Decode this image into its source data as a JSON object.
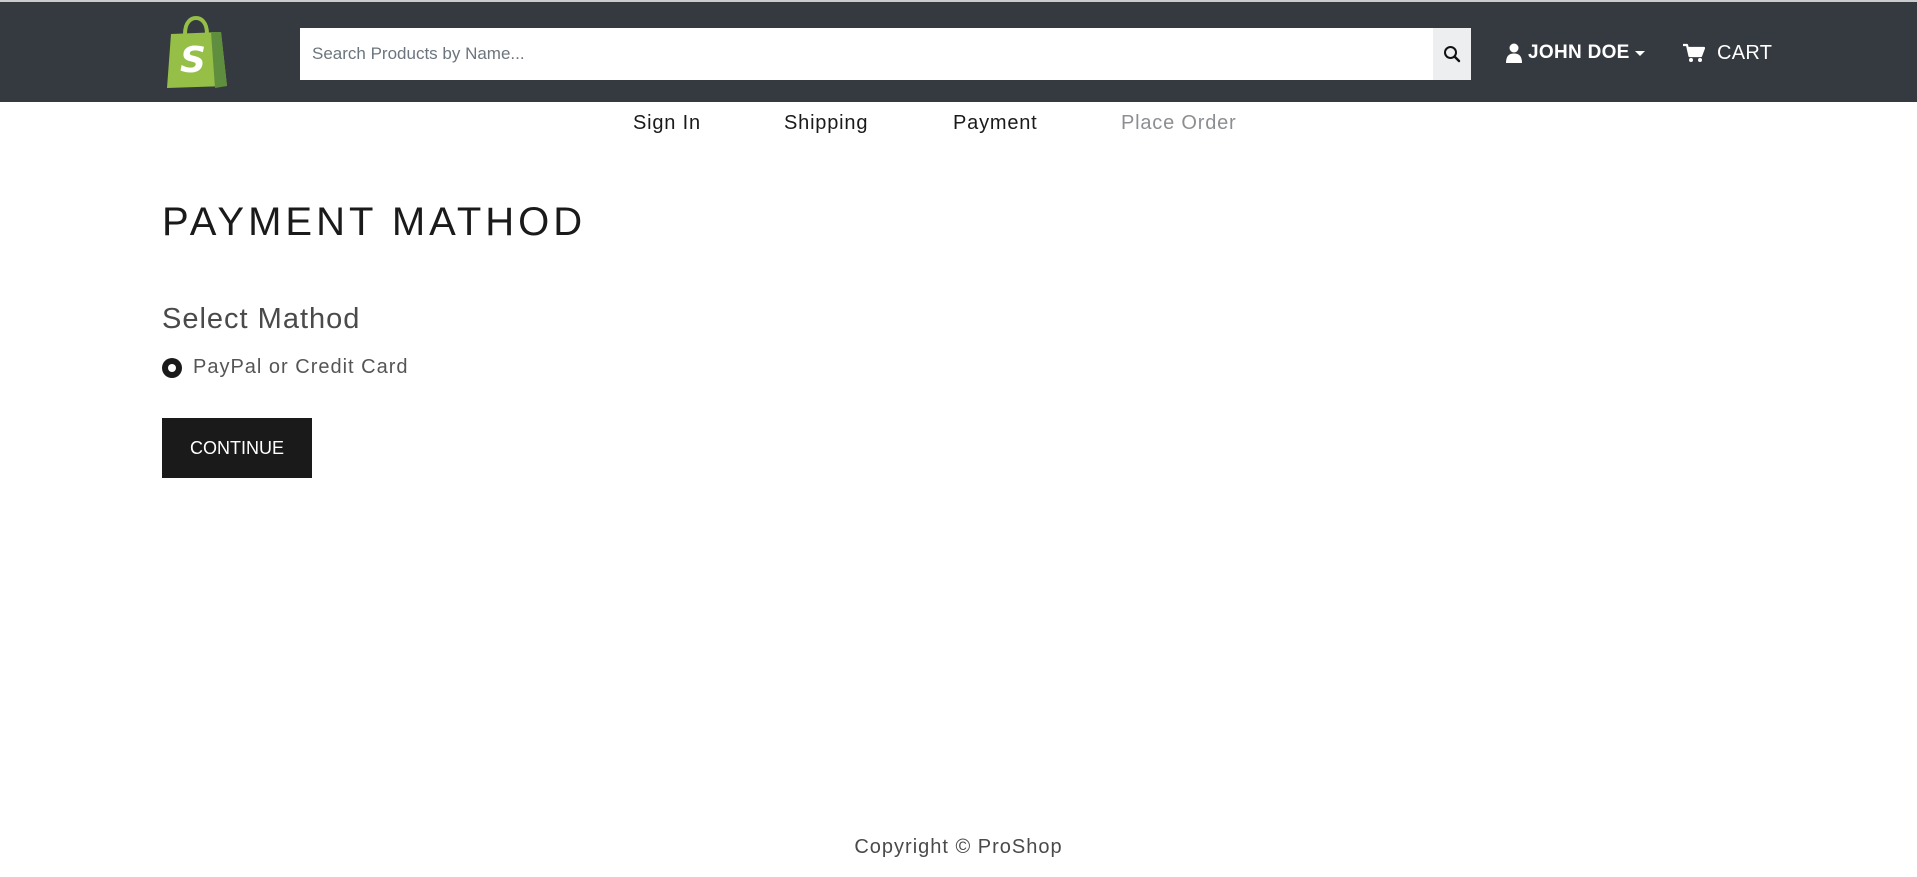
{
  "header": {
    "logo_icon": "shopify-bag-logo",
    "search": {
      "placeholder": "Search Products by Name...",
      "value": ""
    },
    "user_menu": {
      "label": "JOHN DOE"
    },
    "cart": {
      "label": "CART"
    }
  },
  "steps": [
    {
      "label": "Sign In",
      "enabled": true
    },
    {
      "label": "Shipping",
      "enabled": true
    },
    {
      "label": "Payment",
      "enabled": true
    },
    {
      "label": "Place Order",
      "enabled": false
    }
  ],
  "main": {
    "title": "PAYMENT MATHOD",
    "subtitle": "Select Mathod",
    "payment_option": {
      "label": "PayPal or Credit Card",
      "selected": true
    },
    "continue_label": "CONTINUE"
  },
  "footer": {
    "text": "Copyright © ProShop"
  },
  "colors": {
    "header_bg": "#343a40",
    "logo_green": "#95bf47",
    "button_bg": "#1a1a1a",
    "disabled_step": "#8b8f93"
  }
}
